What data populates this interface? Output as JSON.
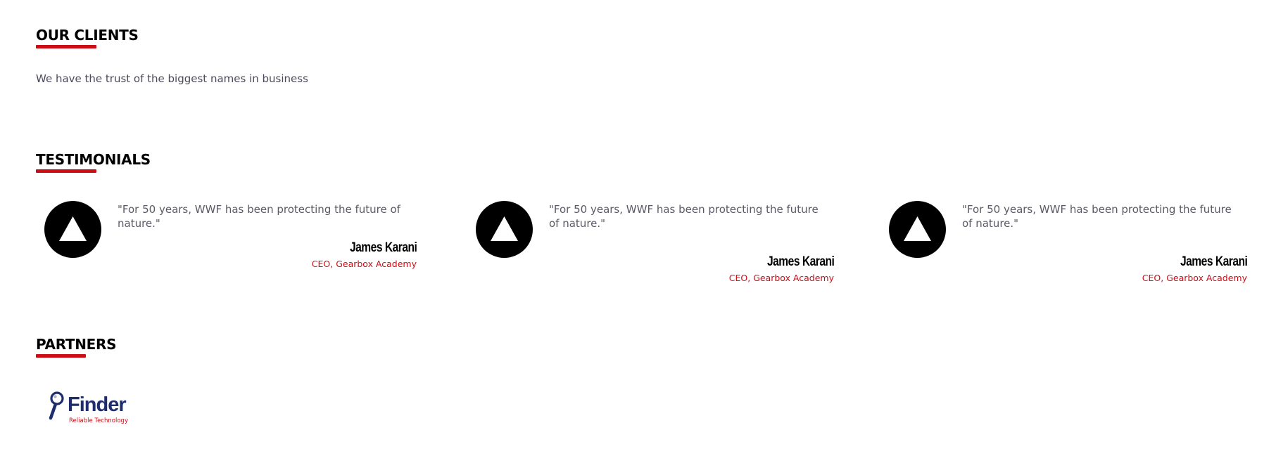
{
  "clients": {
    "title": "OUR CLIENTS",
    "subtitle": "We have the trust of the biggest names in business"
  },
  "testimonials": {
    "title": "TESTIMONIALS",
    "items": [
      {
        "quote": "\"For 50 years, WWF has been protecting the future of nature.\"",
        "author": "James Karani",
        "role": "CEO, Gearbox Academy"
      },
      {
        "quote": "\"For 50 years, WWF has been protecting the future of nature.\"",
        "author": "James Karani",
        "role": "CEO, Gearbox Academy"
      },
      {
        "quote": "\"For 50 years, WWF has been protecting the future of nature.\"",
        "author": "James Karani",
        "role": "CEO, Gearbox Academy"
      }
    ]
  },
  "partners": {
    "title": "PARTNERS",
    "logos": [
      {
        "name": "Finder",
        "tagline": "Reliable Technology",
        "icon": "magnifier-icon"
      }
    ]
  },
  "colors": {
    "accent": "#cc0d16",
    "brand_navy": "#1e2d6b",
    "text_muted": "#5a5a66"
  }
}
